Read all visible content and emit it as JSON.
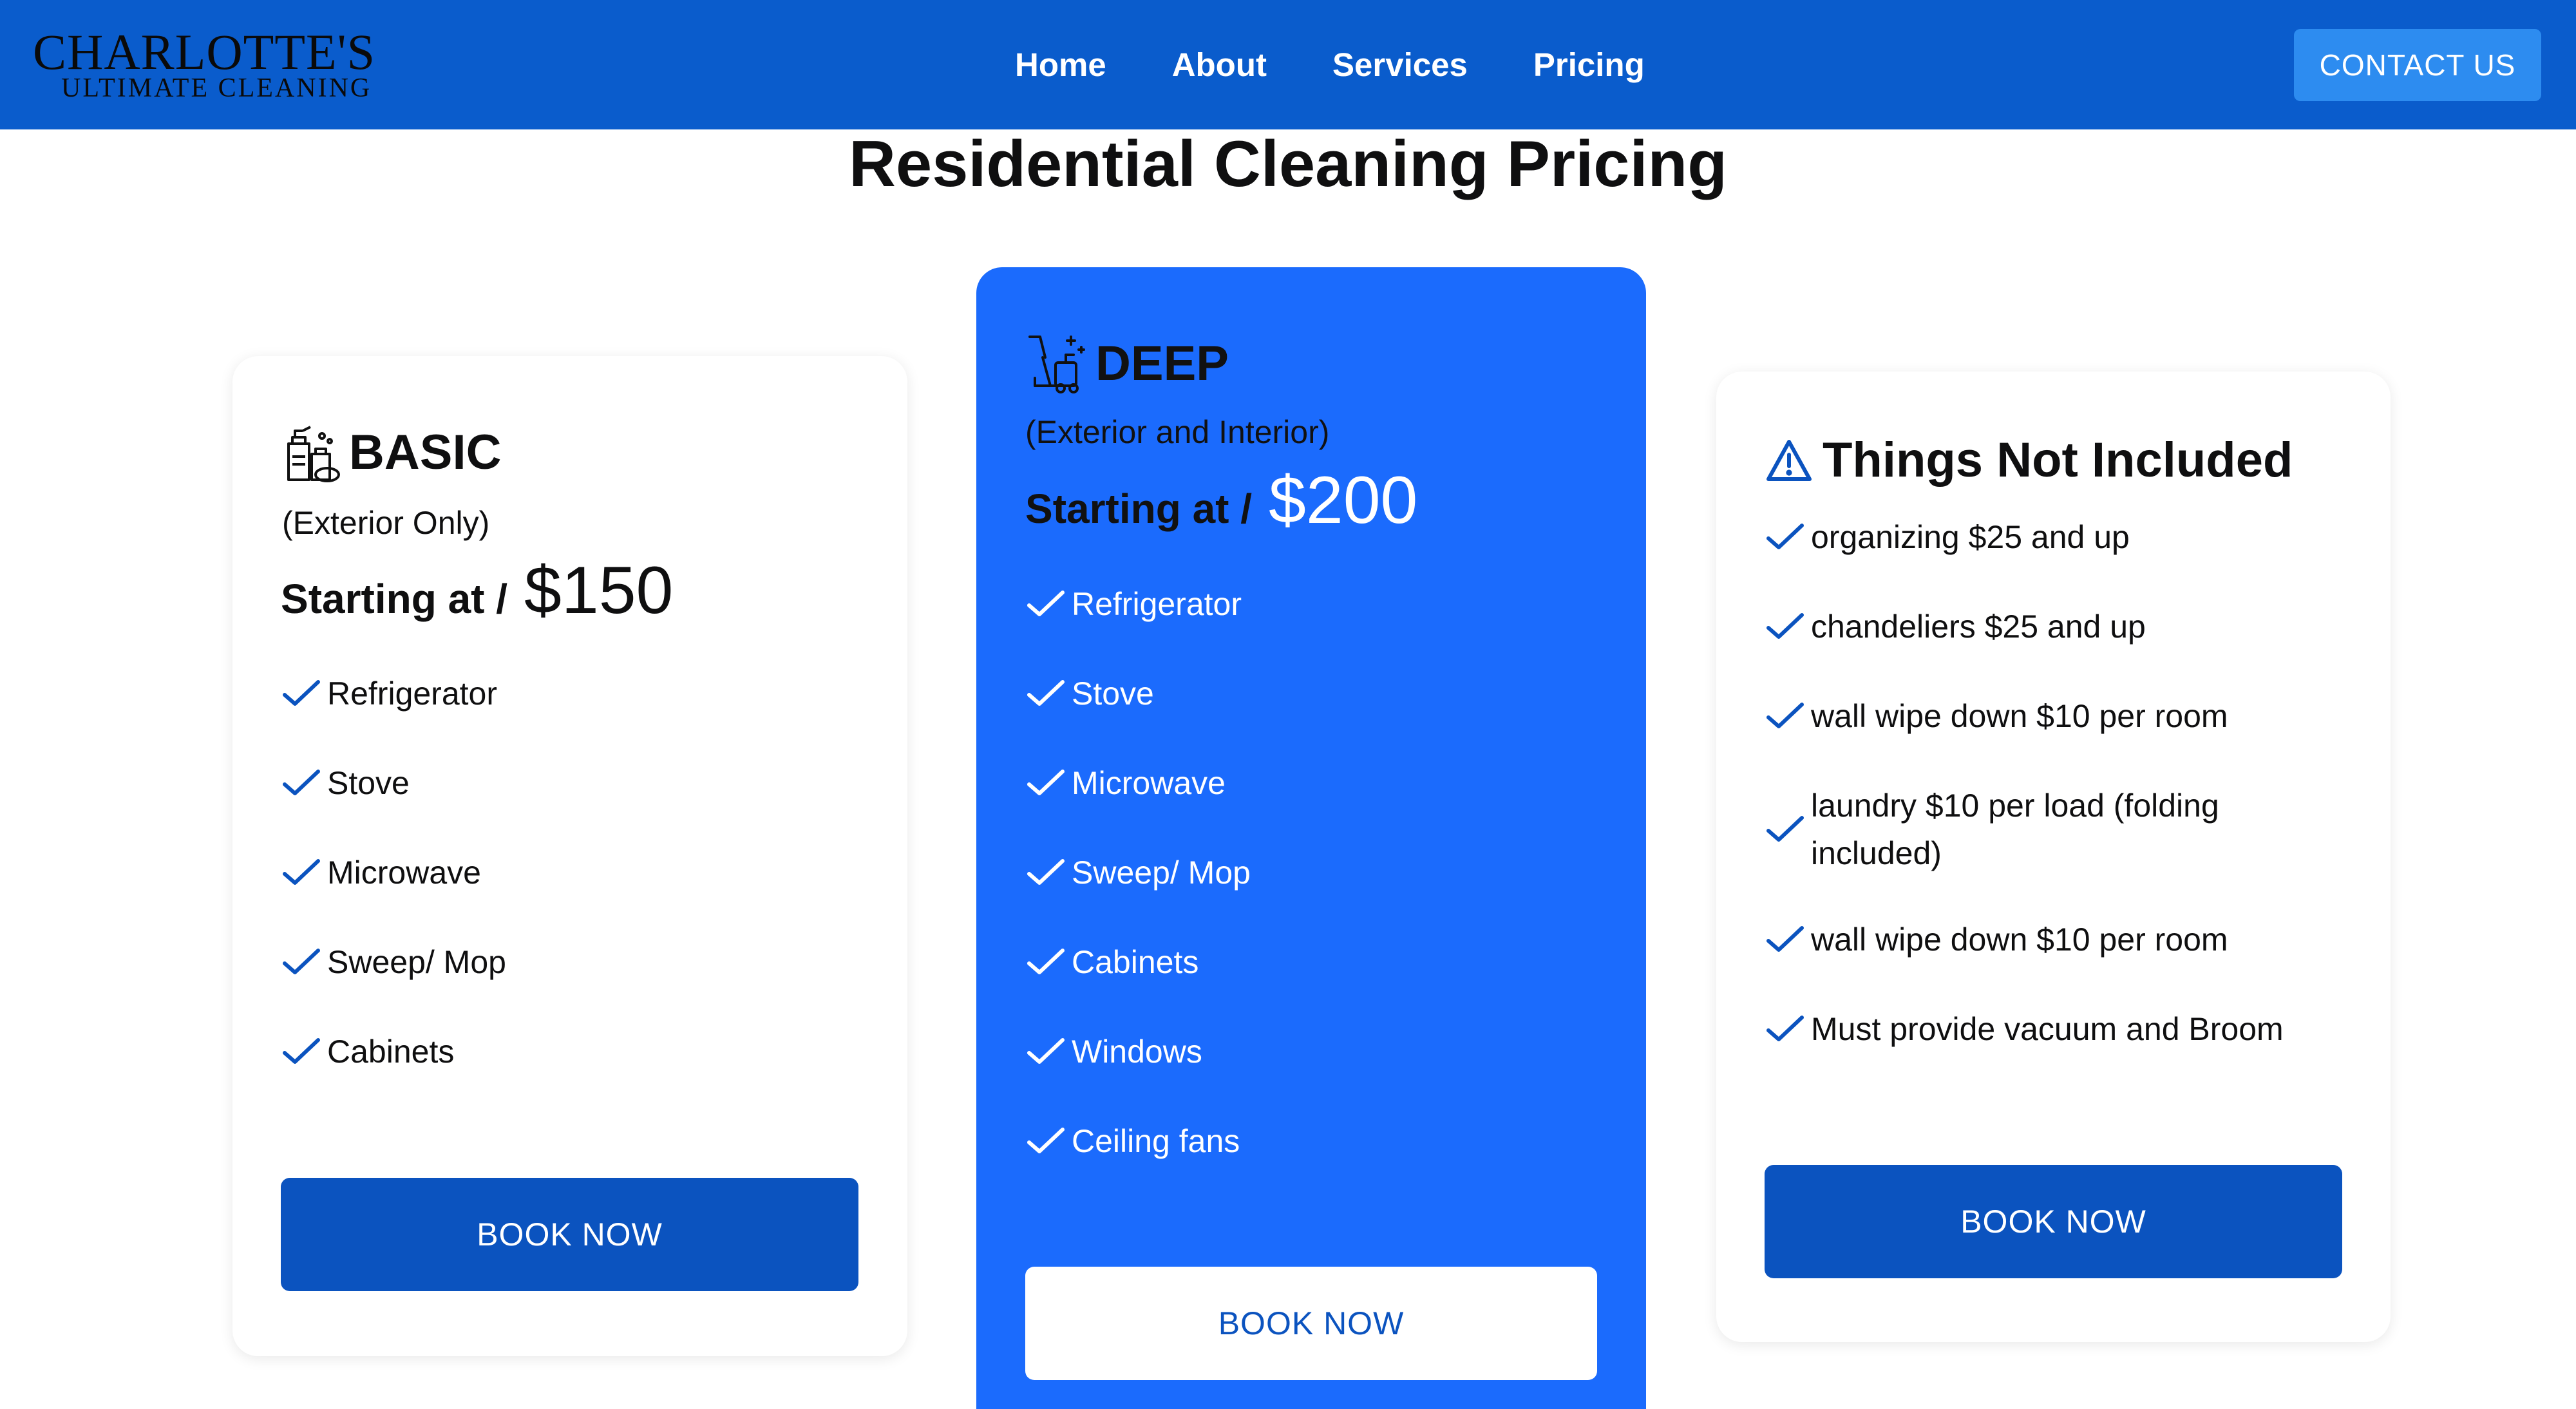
{
  "header": {
    "logo_line1": "CHARLOTTE'S",
    "logo_line2": "ULTIMATE CLEANING",
    "nav": [
      "Home",
      "About",
      "Services",
      "Pricing"
    ],
    "contact_label": "CONTACT US"
  },
  "page": {
    "title": "Residential Cleaning Pricing"
  },
  "plans": {
    "basic": {
      "name": "BASIC",
      "subtitle": "(Exterior Only)",
      "price_label": "Starting at /",
      "price": "$150",
      "icon": "cleaning-supplies-icon",
      "features": [
        "Refrigerator",
        "Stove",
        "Microwave",
        "Sweep/ Mop",
        "Cabinets"
      ],
      "button": "BOOK NOW"
    },
    "deep": {
      "name": "DEEP",
      "subtitle": "(Exterior and Interior)",
      "price_label": "Starting at /",
      "price": "$200",
      "icon": "vacuum-cleaner-icon",
      "features": [
        "Refrigerator",
        "Stove",
        "Microwave",
        "Sweep/ Mop",
        "Cabinets",
        "Windows",
        "Ceiling fans"
      ],
      "button": "BOOK NOW"
    },
    "extras": {
      "name": "Things Not Included",
      "icon": "warning-icon",
      "features": [
        "organizing $25 and up",
        "chandeliers $25 and up",
        "wall wipe down $10 per room",
        "laundry $10 per load (folding included)",
        "wall wipe down $10 per room",
        "Must provide vacuum and Broom"
      ],
      "button": "BOOK NOW"
    }
  },
  "colors": {
    "header_bg": "#0a5ccc",
    "accent_blue": "#1b6bfd",
    "button_dark": "#0b53bf",
    "contact_button": "#2d8cf0",
    "check_dark": "#0b53bf",
    "check_light": "#ffffff"
  }
}
